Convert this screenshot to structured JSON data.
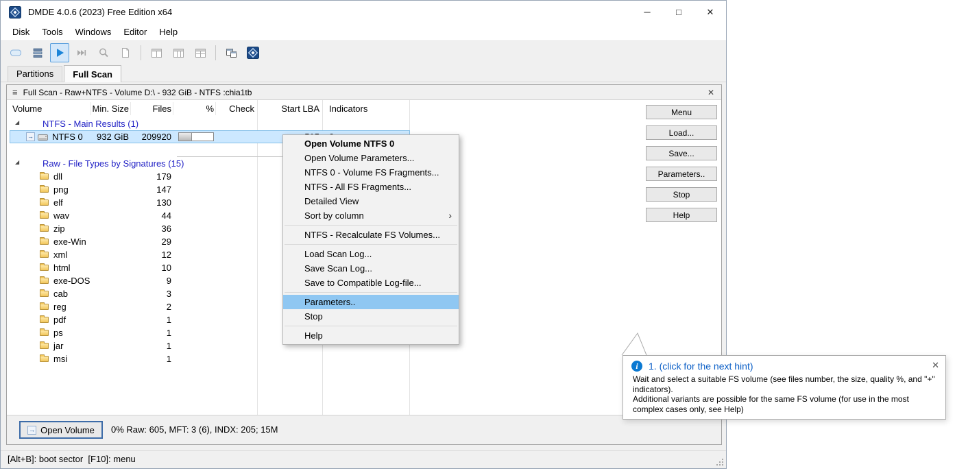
{
  "window": {
    "title": "DMDE 4.0.6 (2023) Free Edition x64",
    "controls": {
      "minimize": "─",
      "maximize": "□",
      "close": "✕"
    }
  },
  "icons": {
    "hamburger": "≡",
    "close": "✕",
    "submenu": "›",
    "info": "i",
    "tree_expanded": "◢",
    "open_arrow": "→"
  },
  "menubar": {
    "items": [
      "Disk",
      "Tools",
      "Windows",
      "Editor",
      "Help"
    ]
  },
  "tabs": [
    {
      "label": "Partitions",
      "active": false
    },
    {
      "label": "Full Scan",
      "active": true
    }
  ],
  "panel": {
    "title": "Full Scan - Raw+NTFS - Volume D:\\ - 932 GiB - NTFS :chia1tb",
    "columns": [
      "Volume",
      "Min. Size",
      "Files",
      "%",
      "Check",
      "Start LBA",
      "Indicators"
    ],
    "tree": {
      "groups": [
        {
          "label": "NTFS - Main Results (1)",
          "rows": [
            {
              "kind": "volume",
              "name": "NTFS 0",
              "min_size": "932 GiB",
              "files": "209920",
              "pct_fill": 38,
              "check": "",
              "start_lba": "515",
              "indicators": "0",
              "selected": true
            }
          ]
        },
        {
          "label": "Raw - File Types by Signatures (15)",
          "rows": [
            {
              "name": "dll",
              "files": "179"
            },
            {
              "name": "png",
              "files": "147"
            },
            {
              "name": "elf",
              "files": "130"
            },
            {
              "name": "wav",
              "files": "44"
            },
            {
              "name": "zip",
              "files": "36"
            },
            {
              "name": "exe-Win",
              "files": "29"
            },
            {
              "name": "xml",
              "files": "12"
            },
            {
              "name": "html",
              "files": "10"
            },
            {
              "name": "exe-DOS",
              "files": "9"
            },
            {
              "name": "cab",
              "files": "3"
            },
            {
              "name": "reg",
              "files": "2"
            },
            {
              "name": "pdf",
              "files": "1"
            },
            {
              "name": "ps",
              "files": "1"
            },
            {
              "name": "jar",
              "files": "1"
            },
            {
              "name": "msi",
              "files": "1"
            }
          ]
        }
      ]
    },
    "buttons": [
      "Menu",
      "Load...",
      "Save...",
      "Parameters..",
      "Stop",
      "Help"
    ],
    "footer": {
      "open_volume": "Open Volume",
      "status": "0% Raw: 605, MFT: 3 (6), INDX: 205; 15M"
    }
  },
  "context_menu": {
    "items": [
      {
        "label": "Open Volume NTFS 0",
        "bold": true
      },
      {
        "label": "Open Volume Parameters..."
      },
      {
        "label": "NTFS 0 - Volume FS Fragments..."
      },
      {
        "label": "NTFS - All FS Fragments..."
      },
      {
        "label": "Detailed View"
      },
      {
        "label": "Sort by column",
        "submenu": true
      },
      {
        "separator": true
      },
      {
        "label": "NTFS - Recalculate FS Volumes..."
      },
      {
        "separator": true
      },
      {
        "label": "Load Scan Log..."
      },
      {
        "label": "Save Scan Log..."
      },
      {
        "label": "Save to Compatible Log-file..."
      },
      {
        "separator": true
      },
      {
        "label": "Parameters..",
        "highlighted": true
      },
      {
        "label": "Stop"
      },
      {
        "separator": true
      },
      {
        "label": "Help"
      }
    ]
  },
  "hint": {
    "title": "1. (click for the next hint)",
    "p1": "Wait and select a suitable FS volume (see files number, the size, quality %, and \"+\" indicators).",
    "p2": "Additional variants are possible for the same FS volume (for use in the most complex cases only, see Help)"
  },
  "statusbar": {
    "text": "[Alt+B]: boot sector  [F10]: menu"
  }
}
